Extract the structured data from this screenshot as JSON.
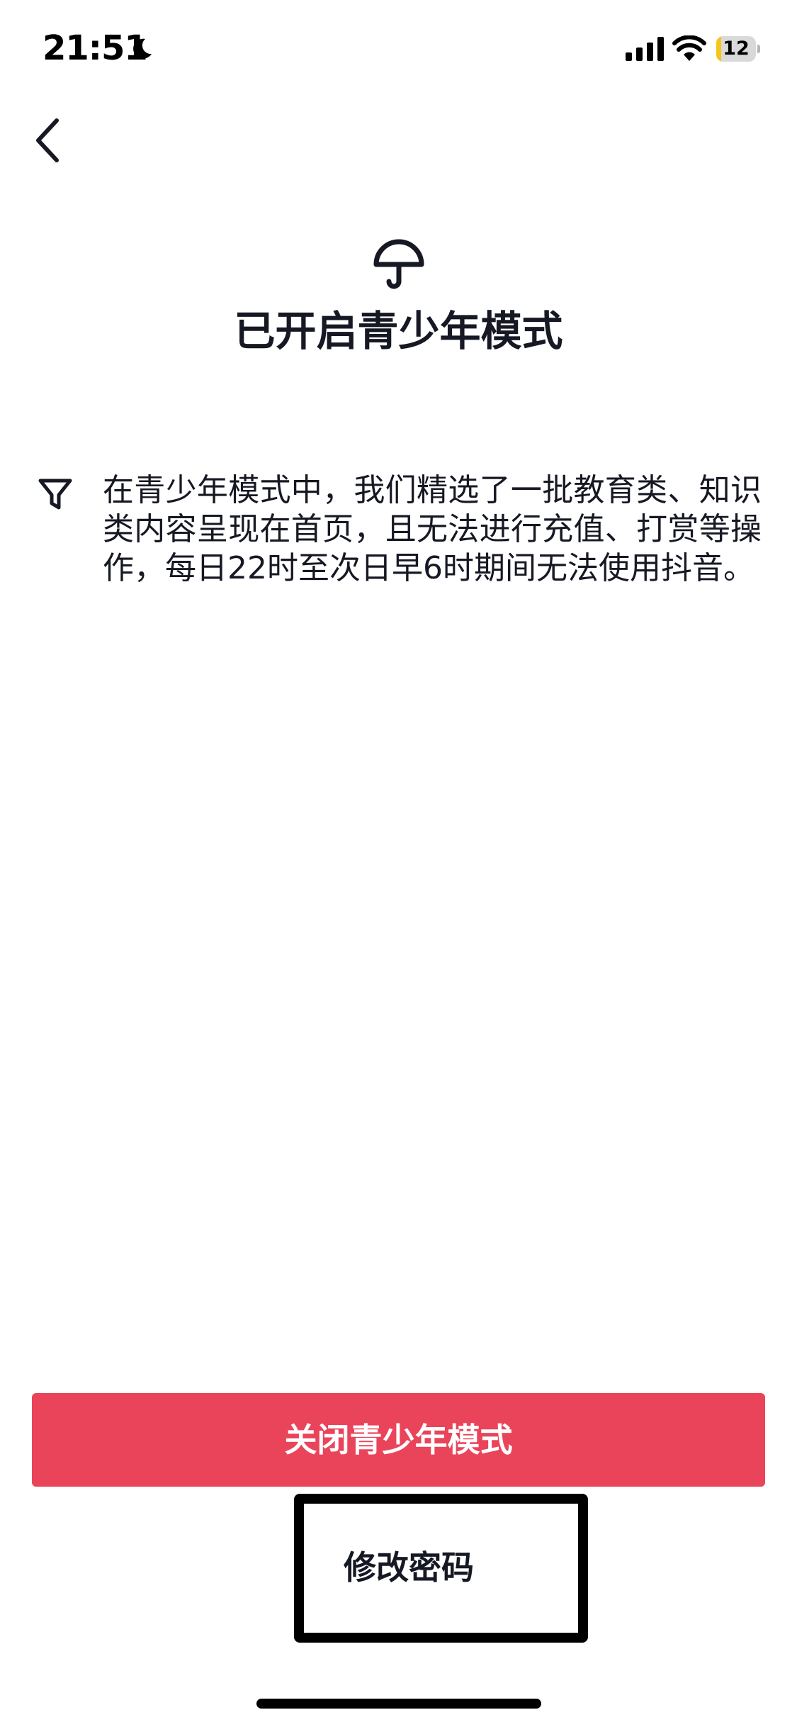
{
  "status_bar": {
    "time": "21:51",
    "battery_level": "12",
    "battery_fraction": 0.12,
    "icons": [
      "moon-icon",
      "signal-icon",
      "wifi-icon",
      "battery-icon"
    ]
  },
  "nav": {
    "back_icon": "chevron-left-icon"
  },
  "header": {
    "icon": "umbrella-icon",
    "title": "已开启青少年模式"
  },
  "info": {
    "icon": "filter-icon",
    "text": "在青少年模式中，我们精选了一批教育类、知识类内容呈现在首页，且无法进行充值、打赏等操作，每日22时至次日早6时期间无法使用抖音。"
  },
  "actions": {
    "primary_label": "关闭青少年模式",
    "secondary_label": "修改密码"
  },
  "colors": {
    "primary_button": "#ea445a",
    "text": "#161823",
    "battery_accent": "#f5c518"
  }
}
